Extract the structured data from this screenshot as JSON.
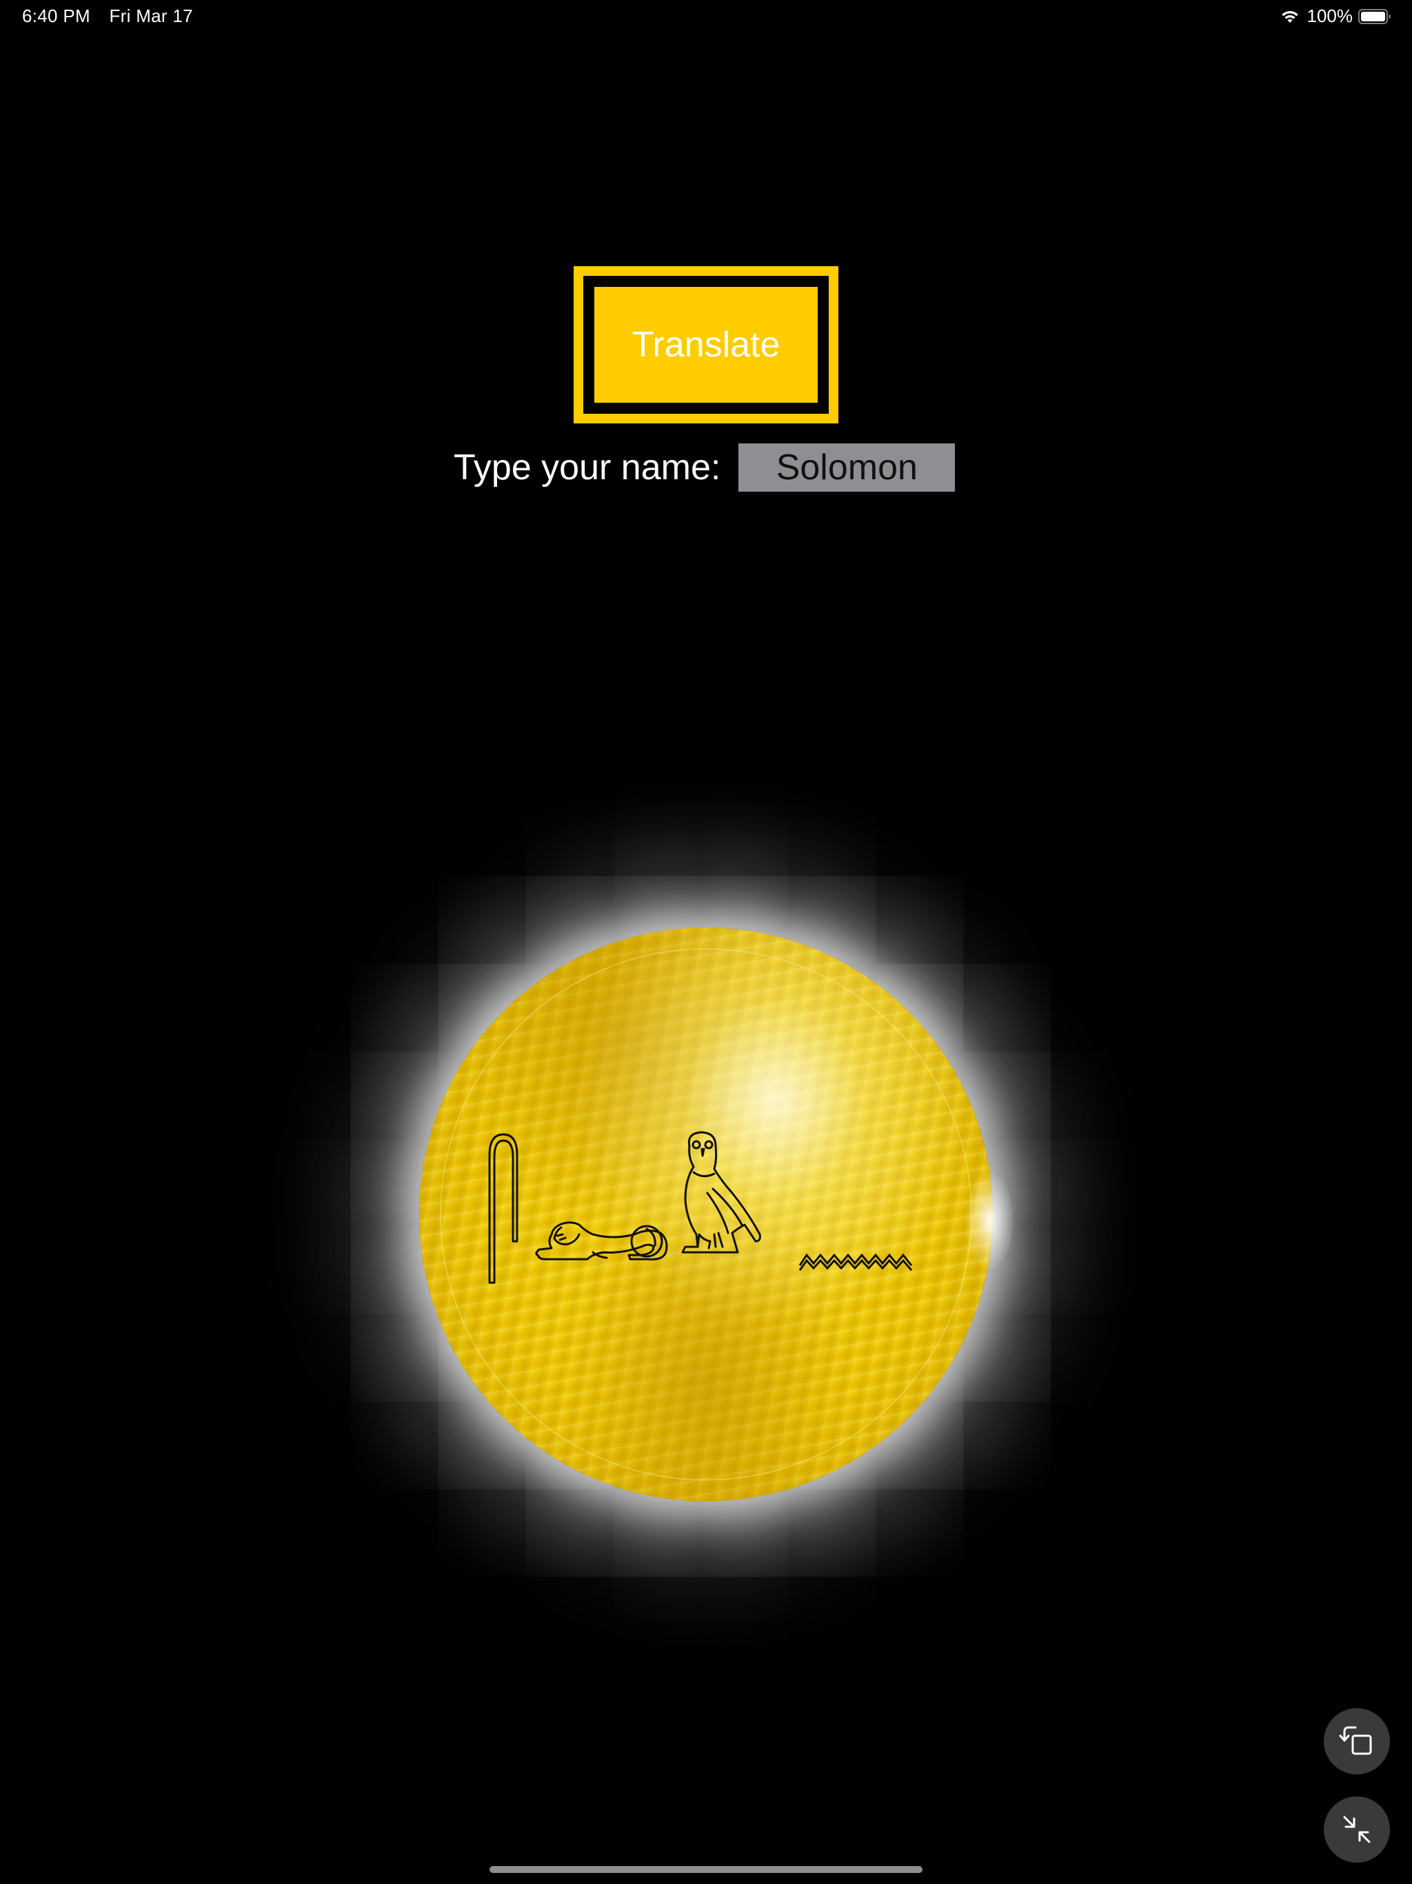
{
  "status_bar": {
    "time": "6:40 PM",
    "date": "Fri Mar 17",
    "battery_percent": "100%",
    "battery_level": 1.0
  },
  "main": {
    "translate_button_label": "Translate",
    "name_label": "Type your name:",
    "name_input_value": "Solomon"
  },
  "disc": {
    "glyphs": [
      "reed-leaf-icon",
      "lion-icon",
      "owl-icon",
      "water-icon"
    ]
  },
  "floating_controls": {
    "rotate_icon": "rotate-screen-icon",
    "collapse_icon": "collapse-arrows-icon"
  },
  "colors": {
    "accent": "#FFCC00",
    "background": "#000000",
    "input_bg": "#8E8E93"
  }
}
